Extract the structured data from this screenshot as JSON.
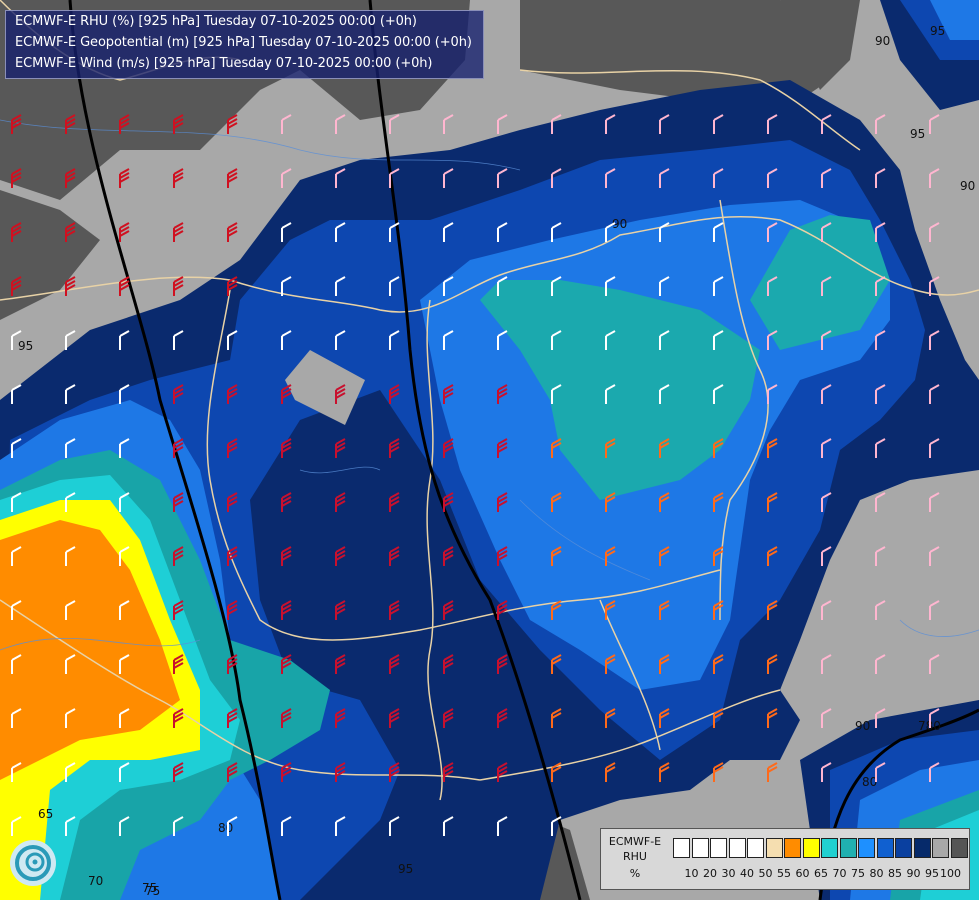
{
  "title": {
    "line1": "ECMWF-E RHU (%) [925 hPa] Tuesday 07-10-2025 00:00 (+0h)",
    "line2": "ECMWF-E Geopotential (m) [925 hPa] Tuesday 07-10-2025 00:00 (+0h)",
    "line3": "ECMWF-E Wind (m/s) [925 hPa] Tuesday 07-10-2025 00:00 (+0h)"
  },
  "legend": {
    "model": "ECMWF-E",
    "variable": "RHU",
    "unit": "%",
    "ticks": [
      "10",
      "20",
      "30",
      "40",
      "50",
      "55",
      "60",
      "65",
      "70",
      "75",
      "80",
      "85",
      "90",
      "95",
      "100"
    ],
    "colors": [
      "#ffffff",
      "#ffffff",
      "#ffffff",
      "#ffffff",
      "#ffffff",
      "#f5deb0",
      "#ff8c00",
      "#ffff00",
      "#20d0d0",
      "#20b0b0",
      "#1e90ff",
      "#1060d0",
      "#0a40a0",
      "#062a6a",
      "#a8a8a8",
      "#555555"
    ]
  },
  "contour_labels": {
    "rhu": [
      "95",
      "90",
      "95",
      "90",
      "75",
      "80",
      "90",
      "95",
      "65",
      "70",
      "75",
      "80",
      "95",
      "90"
    ],
    "geopotential": [
      "780"
    ]
  },
  "logo_icon": "ecmwf-logo-icon"
}
